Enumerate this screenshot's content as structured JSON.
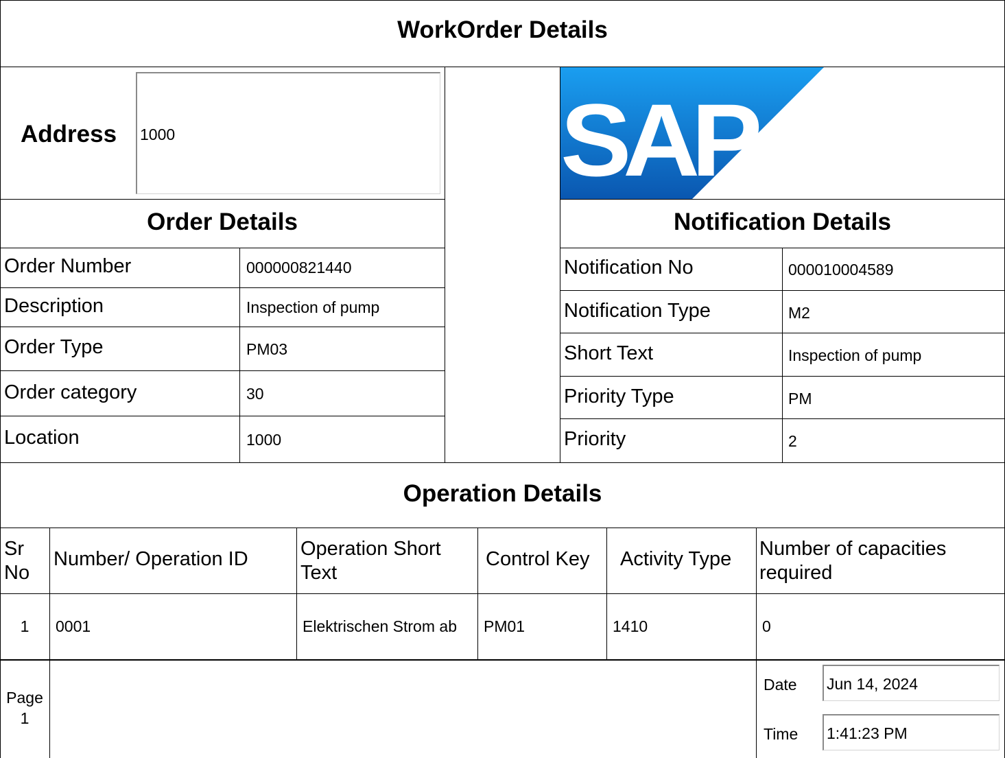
{
  "header": {
    "title": "WorkOrder Details"
  },
  "address": {
    "label": "Address",
    "value": "1000"
  },
  "logo": {
    "text": "SAP",
    "bg_top": "#1a9ef0",
    "bg_bottom": "#0a57b0"
  },
  "order": {
    "title": "Order Details",
    "rows": [
      {
        "label": "Order Number",
        "value": "000000821440"
      },
      {
        "label": "Description",
        "value": "Inspection of pump"
      },
      {
        "label": "Order Type",
        "value": "PM03"
      },
      {
        "label": "Order category",
        "value": "30"
      },
      {
        "label": "Location",
        "value": "1000"
      }
    ]
  },
  "notification": {
    "title": "Notification Details",
    "rows": [
      {
        "label": "Notification No",
        "value": "000010004589"
      },
      {
        "label": "Notification Type",
        "value": "M2"
      },
      {
        "label": "Short Text",
        "value": "Inspection of pump"
      },
      {
        "label": "Priority Type",
        "value": "PM"
      },
      {
        "label": "Priority",
        "value": "2"
      }
    ]
  },
  "operations": {
    "title": "Operation Details",
    "columns": {
      "sr": [
        "Sr",
        "No"
      ],
      "number": "Number/ Operation ID",
      "short_text": [
        "Operation Short",
        "Text"
      ],
      "control_key": "Control Key",
      "activity_type": "Activity Type",
      "capacities": [
        "Number of capacities",
        "required"
      ]
    },
    "rows": [
      {
        "sr": "1",
        "number": "0001",
        "short_text": "Elektrischen Strom ab",
        "control_key": "PM01",
        "activity_type": "1410",
        "capacities": "0"
      }
    ]
  },
  "footer": {
    "page_label": "Page",
    "page_number": "1",
    "date_label": "Date",
    "date_value": "Jun 14, 2024",
    "time_label": "Time",
    "time_value": "1:41:23 PM"
  }
}
